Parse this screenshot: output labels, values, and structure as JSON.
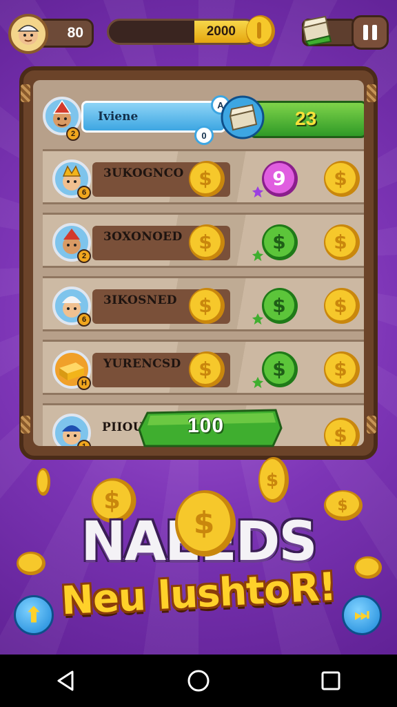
{
  "hud": {
    "level": "80",
    "coins": "2000",
    "coin_fill_ratio": 0.42
  },
  "board": {
    "top_row": {
      "name": "Iviene",
      "badge": "2",
      "value": "23",
      "circle_top": "A",
      "circle_bottom": "0"
    },
    "rows": [
      {
        "name": "3UKOGNCO",
        "badge": "6",
        "reward": "pink-9-coin"
      },
      {
        "name": "3OXONOED",
        "badge": "2",
        "reward": "green-dollar-coin"
      },
      {
        "name": "3IKOSNED",
        "badge": "6",
        "reward": "green-dollar-coin"
      },
      {
        "name": "YURENCSD",
        "badge": "H",
        "reward": "green-dollar-coin"
      }
    ],
    "last_row": {
      "name": "PIIOUGI",
      "badge": "1",
      "value": "100"
    }
  },
  "headline": {
    "line1": "NAEEDS",
    "line2": "Neu lushtoR!"
  },
  "buttons": {
    "left_symbol": "⬆",
    "right_symbol": "⏭"
  },
  "colors": {
    "background": "#7d35b6",
    "gold": "#f2b41a",
    "green": "#3fae2f",
    "pink": "#d94ad4"
  }
}
